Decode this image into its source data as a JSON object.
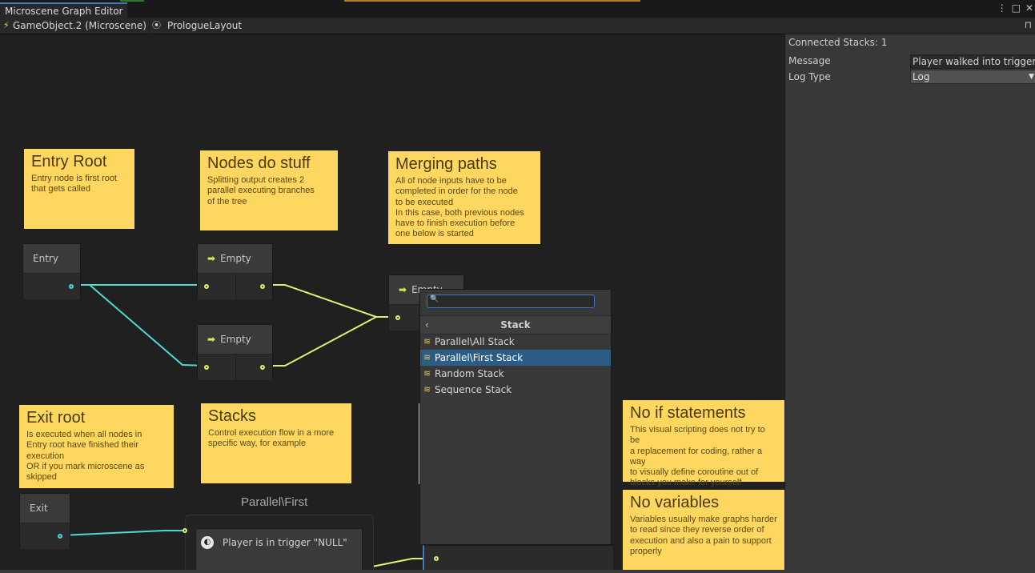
{
  "window": {
    "title": "Microscene Graph Editor"
  },
  "breadcrumb": {
    "object": "GameObject.2 (Microscene)",
    "layout": "PrologueLayout"
  },
  "notes": {
    "entry_root": {
      "title": "Entry Root",
      "body": "Entry node is first root\nthat gets called"
    },
    "nodes_do_stuff": {
      "title": "Nodes do stuff",
      "body": "Splitting output creates 2\nparallel executing branches\nof the tree"
    },
    "merging_paths": {
      "title": "Merging paths",
      "body": "All of node inputs have to be\ncompleted in order for the node\nto be executed\nIn this case, both previous nodes\nhave to finish execution before\none below is started"
    },
    "exit_root": {
      "title": "Exit root",
      "body": "Is executed when all nodes in\nEntry root have finished their\nexecution\nOR if you mark microscene as\nskipped"
    },
    "stacks": {
      "title": "Stacks",
      "body": "Control execution flow in a more\nspecific way, for example"
    },
    "no_if": {
      "title": "No if statements",
      "body": "This visual scripting does not try to be\na replacement for coding, rather a way\nto visually define coroutine out of\nblocks you make for yourself"
    },
    "no_variables": {
      "title": "No variables",
      "body": "Variables usually make graphs harder\nto read since they reverse order of\nexecution and also a pain to support\nproperly"
    }
  },
  "nodes": {
    "entry": "Entry",
    "empty_1": "Empty",
    "empty_2": "Empty",
    "empty_3": "Empty",
    "exit": "Exit",
    "stack_group": "Parallel\\First",
    "trigger": "Player is in trigger \"NULL\""
  },
  "search_popup": {
    "query": "",
    "header": "Stack",
    "items": [
      "Parallel\\All Stack",
      "Parallel\\First Stack",
      "Random Stack",
      "Sequence Stack"
    ],
    "selected_index": 1
  },
  "inspector": {
    "connected": "Connected Stacks: 1",
    "message_label": "Message",
    "message_value": "Player walked into trigger",
    "log_type_label": "Log Type",
    "log_type_value": "Log"
  },
  "colors": {
    "note": "#fed760",
    "wire_cyan": "#4fd8d0",
    "wire_green": "#d6f472",
    "selection": "#2c5d87",
    "accent": "#3e78c0"
  }
}
